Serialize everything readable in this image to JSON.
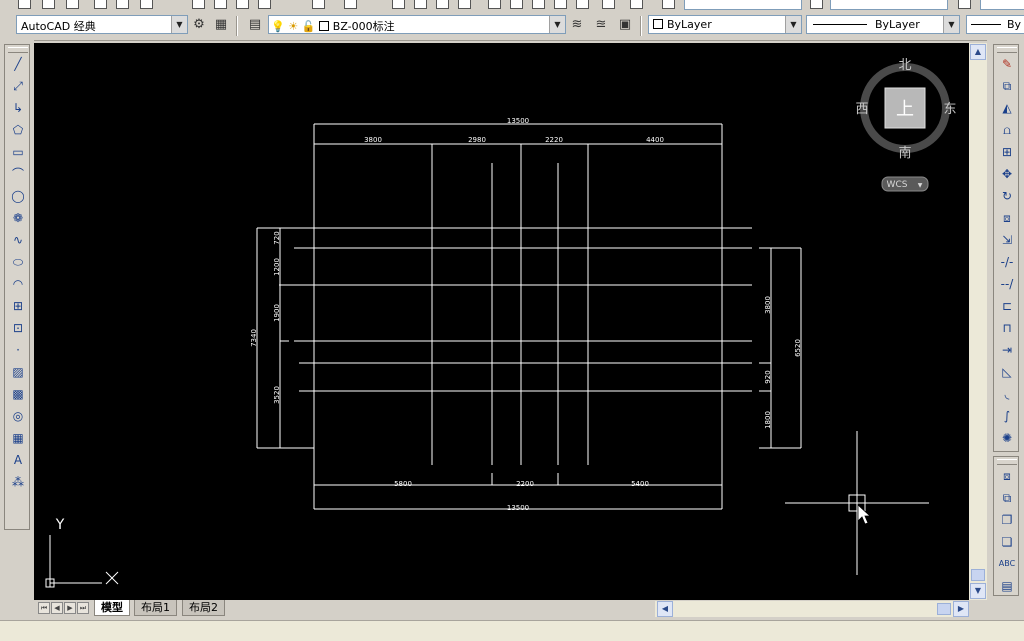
{
  "toolbar": {
    "workspace_value": "AutoCAD 经典",
    "layer_value": "BZ-000标注",
    "color_value": "ByLayer",
    "linetype_value": "ByLayer",
    "lineweight_value": "By"
  },
  "viewcube": {
    "north": "北",
    "south": "南",
    "east": "东",
    "west": "西",
    "face": "上",
    "coord_system": "WCS"
  },
  "ucs": {
    "y_label": "Y"
  },
  "tabs": [
    {
      "label": "模型",
      "active": true
    },
    {
      "label": "布局1",
      "active": false
    },
    {
      "label": "布局2",
      "active": false
    }
  ],
  "drawing": {
    "dim_top_total": "13500",
    "dim_top_segments": [
      "3800",
      "2980",
      "2220",
      "4400"
    ],
    "dim_bottom_segments": [
      "5800",
      "2200",
      "5400"
    ],
    "dim_bottom_total": "13500",
    "dim_left_segments": [
      "720",
      "1200",
      "1900",
      "3520"
    ],
    "dim_left_total": "7340",
    "dim_right_segments": [
      "3800",
      "920",
      "1800"
    ],
    "dim_right_total": "6520"
  },
  "colors": {
    "canvas_bg": "#000000",
    "line_color": "#ffffff",
    "ui_bg": "#d4d0c8"
  }
}
